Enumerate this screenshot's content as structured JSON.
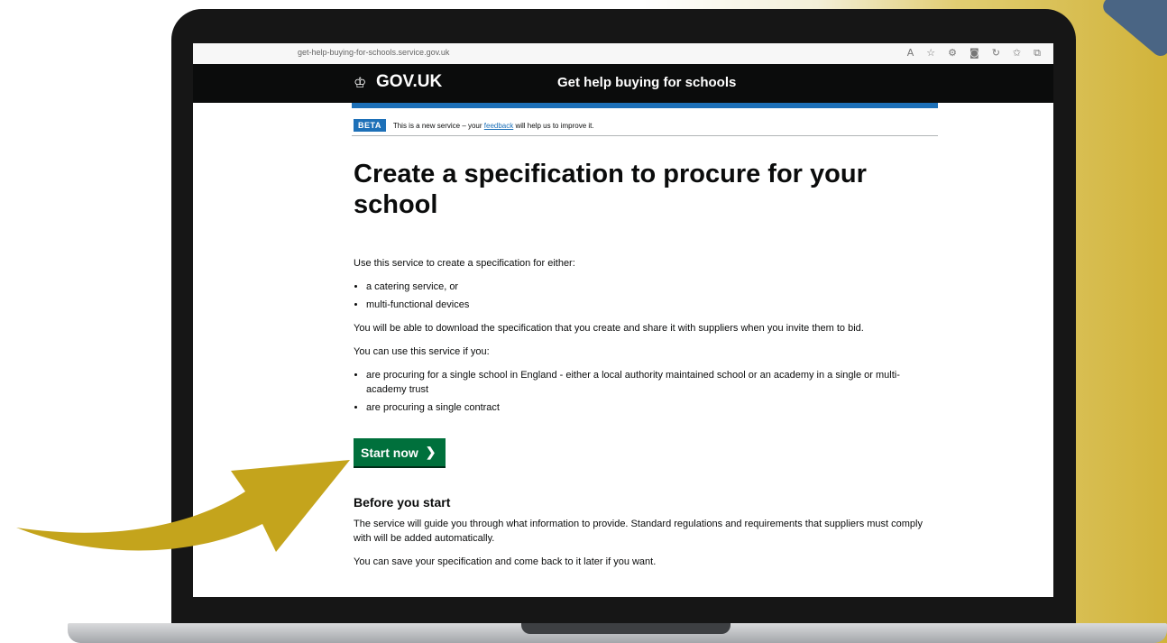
{
  "browser": {
    "url": "get-help-buying-for-schools.service.gov.uk",
    "icons": [
      "read-aloud-icon",
      "favorite-add-icon",
      "extensions-icon",
      "camera-icon",
      "refresh-icon",
      "favorites-icon",
      "collections-icon"
    ]
  },
  "header": {
    "logo": "GOV.UK",
    "service_name": "Get help buying for schools"
  },
  "phase_banner": {
    "tag": "BETA",
    "text_before": "This is a new service – your ",
    "link": "feedback",
    "text_after": " will help us to improve it."
  },
  "main": {
    "title": "Create a specification to procure for your school",
    "intro": "Use this service to create a specification for either:",
    "either_list": [
      "a catering service, or",
      "multi-functional devices"
    ],
    "download_text": "You will be able to download the specification that you create and share it with suppliers when you invite them to bid.",
    "can_use": "You can use this service if you:",
    "conditions": [
      "are procuring for a single school in England - either a local authority maintained school or an academy in a single or multi-academy trust",
      "are procuring a single contract"
    ],
    "start_button": "Start now",
    "before_heading": "Before you start",
    "guide_text": "The service will guide you through what information to provide. Standard regulations and requirements that suppliers must comply with will be added automatically.",
    "save_text": "You can save your specification and come back to it later if you want."
  },
  "colors": {
    "header_bg": "#0b0c0c",
    "accent_blue": "#1d70b8",
    "button_green": "#00703c",
    "arrow_gold": "#c4a41c"
  }
}
